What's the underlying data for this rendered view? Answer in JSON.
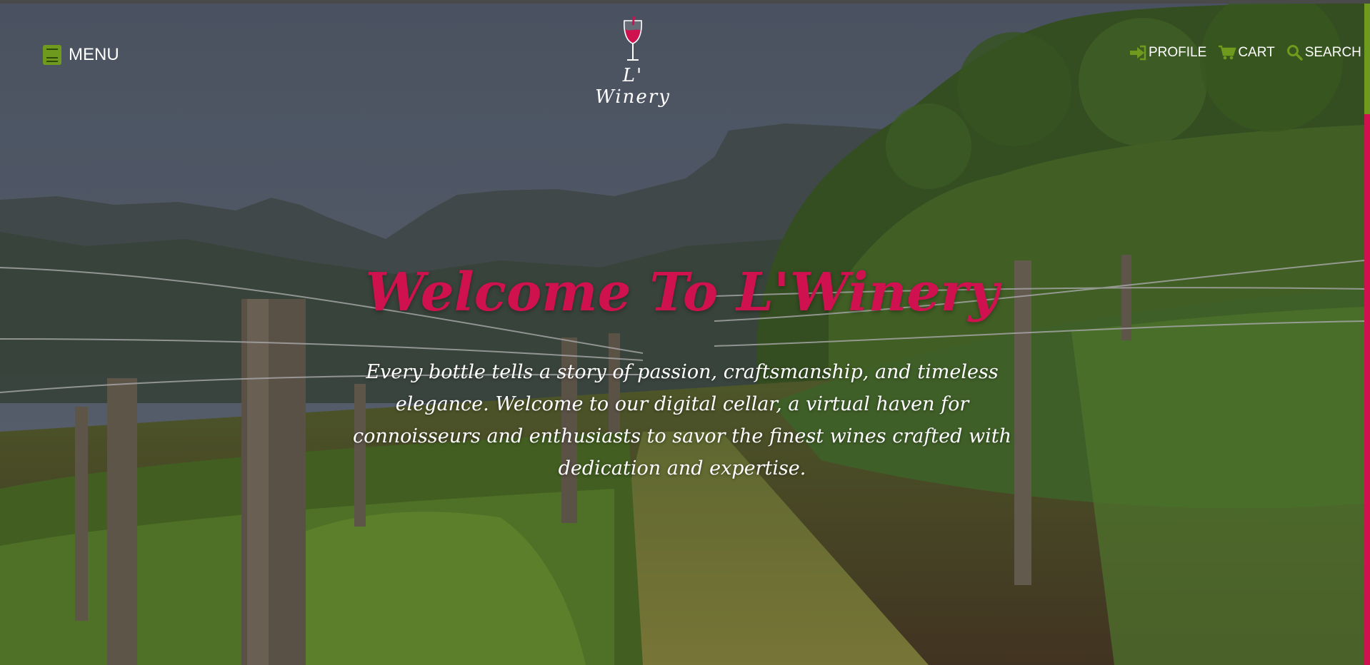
{
  "header": {
    "menu_label": "MENU",
    "logo_text": "L' Winery",
    "nav": {
      "profile_label": "PROFILE",
      "cart_label": "CART",
      "search_label": "SEARCH"
    },
    "icons": {
      "menu": "book-icon",
      "logo": "wine-glass-icon",
      "profile": "sign-in-arrow-icon",
      "cart": "shopping-cart-icon",
      "search": "search-icon"
    }
  },
  "hero": {
    "title": "Welcome To L'Winery",
    "description": "Every bottle tells a story of passion, craftsmanship, and timeless elegance. Welcome to our digital cellar, a virtual haven for connoisseurs and enthusiasts to savor the finest wines crafted with dedication and expertise.",
    "background": "vineyard-with-mountains-photo"
  },
  "colors": {
    "accent_wine": "#cf1150",
    "accent_green": "#6e9b1d",
    "text_light": "#ffffff",
    "sky": "#566070"
  },
  "scrollbar": {
    "position_fraction": 0.0
  }
}
